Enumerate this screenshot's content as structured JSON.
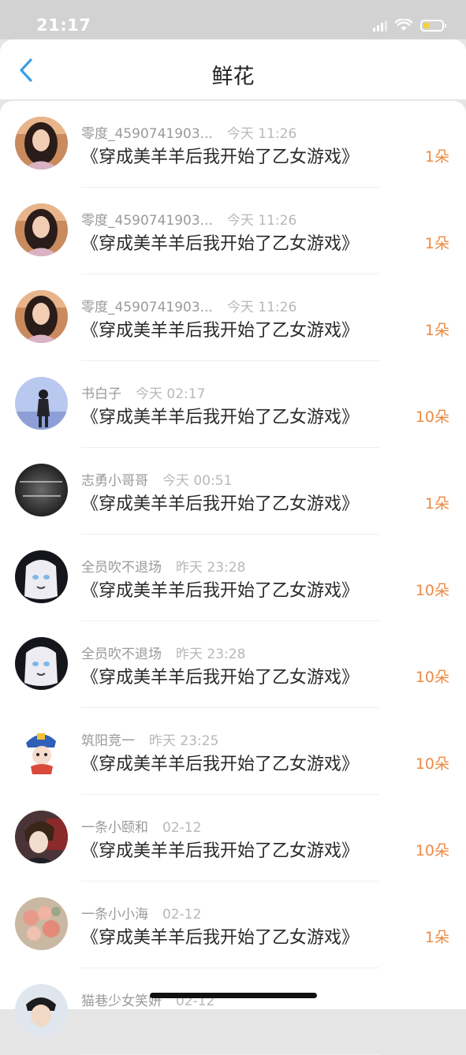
{
  "status_bar": {
    "time": "21:17",
    "battery_level": 0.25,
    "battery_color": "#f3d23a"
  },
  "header": {
    "title": "鲜花",
    "back_icon": "chevron-left-icon",
    "accent_color": "#3b9ee6"
  },
  "gifts": [
    {
      "user": "零度_4590741903...",
      "time": "今天 11:26",
      "book": "《穿成美羊羊后我开始了乙女游戏》",
      "count": "1朵",
      "avatar": "girl-photo"
    },
    {
      "user": "零度_4590741903...",
      "time": "今天 11:26",
      "book": "《穿成美羊羊后我开始了乙女游戏》",
      "count": "1朵",
      "avatar": "girl-photo"
    },
    {
      "user": "零度_4590741903...",
      "time": "今天 11:26",
      "book": "《穿成美羊羊后我开始了乙女游戏》",
      "count": "1朵",
      "avatar": "girl-photo"
    },
    {
      "user": "书白子",
      "time": "今天 02:17",
      "book": "《穿成美羊羊后我开始了乙女游戏》",
      "count": "10朵",
      "avatar": "silhouette-sky"
    },
    {
      "user": "志勇小哥哥",
      "time": "今天 00:51",
      "book": "《穿成美羊羊后我开始了乙女游戏》",
      "count": "1朵",
      "avatar": "dark-text"
    },
    {
      "user": "全员吹不退场",
      "time": "昨天 23:28",
      "book": "《穿成美羊羊后我开始了乙女游戏》",
      "count": "10朵",
      "avatar": "anime-white-hair"
    },
    {
      "user": "全员吹不退场",
      "time": "昨天 23:28",
      "book": "《穿成美羊羊后我开始了乙女游戏》",
      "count": "10朵",
      "avatar": "anime-white-hair"
    },
    {
      "user": "筑阳竞一",
      "time": "昨天 23:25",
      "book": "《穿成美羊羊后我开始了乙女游戏》",
      "count": "10朵",
      "avatar": "cartoon-jiangshi"
    },
    {
      "user": "一条小颐和",
      "time": "02-12",
      "book": "《穿成美羊羊后我开始了乙女游戏》",
      "count": "10朵",
      "avatar": "anime-dark-boy"
    },
    {
      "user": "一条小小海",
      "time": "02-12",
      "book": "《穿成美羊羊后我开始了乙女游戏》",
      "count": "1朵",
      "avatar": "flowers"
    },
    {
      "user": "猫巷少女笑妍",
      "time": "02-12",
      "book": "",
      "count": "",
      "avatar": "person-partial"
    }
  ]
}
